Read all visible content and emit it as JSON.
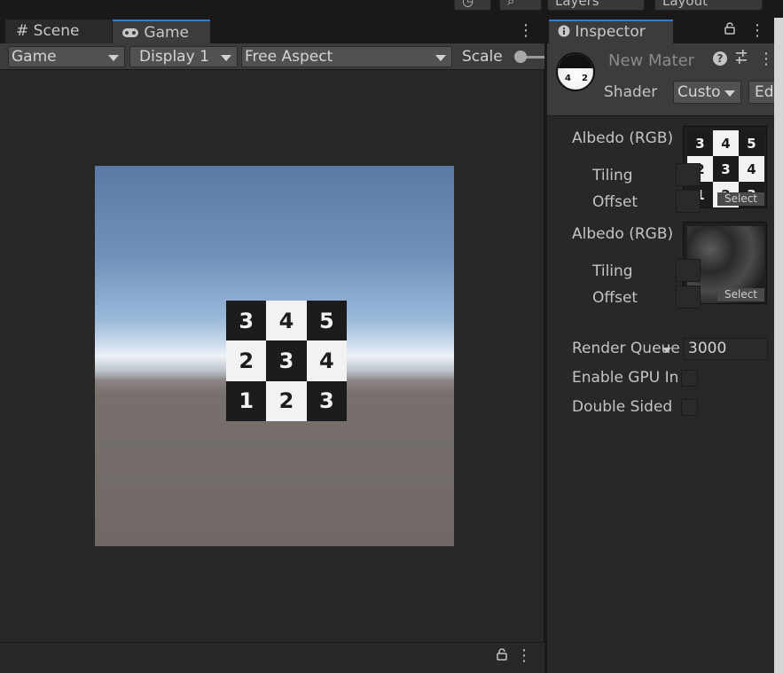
{
  "topbar": {
    "layers_label": "Layers",
    "layout_label": "Layout"
  },
  "tabs": {
    "scene_label": "Scene",
    "game_label": "Game"
  },
  "toolbar": {
    "game_dropdown": "Game",
    "display_dropdown": "Display 1",
    "aspect_dropdown": "Free Aspect",
    "scale_label": "Scale"
  },
  "viewport": {
    "checker_cells": [
      {
        "n": "3",
        "c": "b"
      },
      {
        "n": "4",
        "c": "w"
      },
      {
        "n": "5",
        "c": "b"
      },
      {
        "n": "2",
        "c": "w"
      },
      {
        "n": "3",
        "c": "b"
      },
      {
        "n": "4",
        "c": "w"
      },
      {
        "n": "1",
        "c": "b"
      },
      {
        "n": "2",
        "c": "w"
      },
      {
        "n": "3",
        "c": "b"
      }
    ]
  },
  "inspector": {
    "tab_label": "Inspector",
    "material_name": "New Mater",
    "help_glyph": "?",
    "shader_label": "Shader",
    "shader_value": "Custo",
    "edit_label": "Ed",
    "preview_n1": "4",
    "preview_n2": "2",
    "props": {
      "albedo1_label": "Albedo (RGB)",
      "tiling1_label": "Tiling",
      "offset1_label": "Offset",
      "select1_label": "Select",
      "albedo2_label": "Albedo (RGB)",
      "tiling2_label": "Tiling",
      "offset2_label": "Offset",
      "select2_label": "Select",
      "render_queue_label": "Render Queue",
      "render_queue_value": "3000",
      "gpu_instancing_label": "Enable GPU Instancing",
      "double_sided_label": "Double Sided"
    },
    "tex1_cells": [
      {
        "n": "3",
        "c": "b"
      },
      {
        "n": "4",
        "c": "w"
      },
      {
        "n": "5",
        "c": "b"
      },
      {
        "n": "2",
        "c": "w"
      },
      {
        "n": "3",
        "c": "b"
      },
      {
        "n": "4",
        "c": "w"
      },
      {
        "n": "1",
        "c": "b"
      },
      {
        "n": "2",
        "c": "w"
      },
      {
        "n": "3",
        "c": "b"
      }
    ]
  },
  "colors": {
    "accent": "#3a79bb",
    "panel_bg": "#282828",
    "header_bg": "#3c3c3c"
  }
}
